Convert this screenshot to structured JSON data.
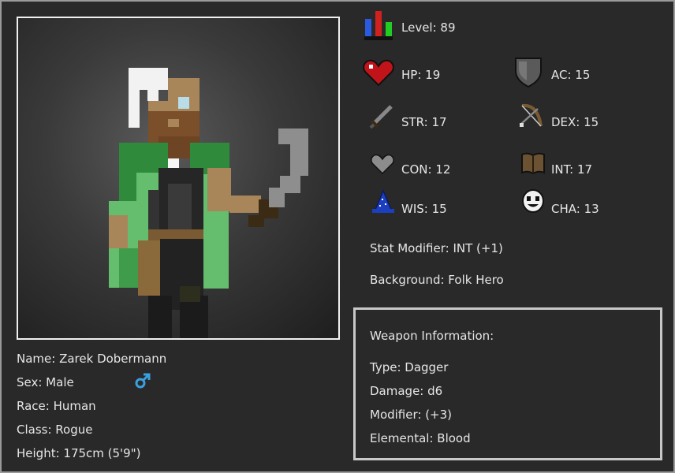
{
  "character": {
    "name_line": "Name: Zarek Dobermann",
    "sex_line": "Sex: Male",
    "race_line": "Race: Human",
    "class_line": "Class: Rogue",
    "height_line": "Height: 175cm (5'9\")",
    "sex_icon": "male-symbol-icon"
  },
  "stats": {
    "level": "Level: 89",
    "hp": "HP: 19",
    "ac": "AC: 15",
    "str": "STR: 17",
    "dex": "DEX: 15",
    "con": "CON: 12",
    "int": "INT: 17",
    "wis": "WIS: 15",
    "cha": "CHA: 13",
    "stat_modifier": "Stat Modifier: INT (+1)",
    "background": "Background: Folk Hero"
  },
  "weapon": {
    "title": "Weapon Information:",
    "type": "Type: Dagger",
    "damage": "Damage: d6",
    "modifier": "Modifier: (+3)",
    "elemental": "Elemental: Blood"
  },
  "colors": {
    "background": "#292929",
    "male_symbol": "#3aa0e0",
    "cape": "#3f9c4a"
  }
}
